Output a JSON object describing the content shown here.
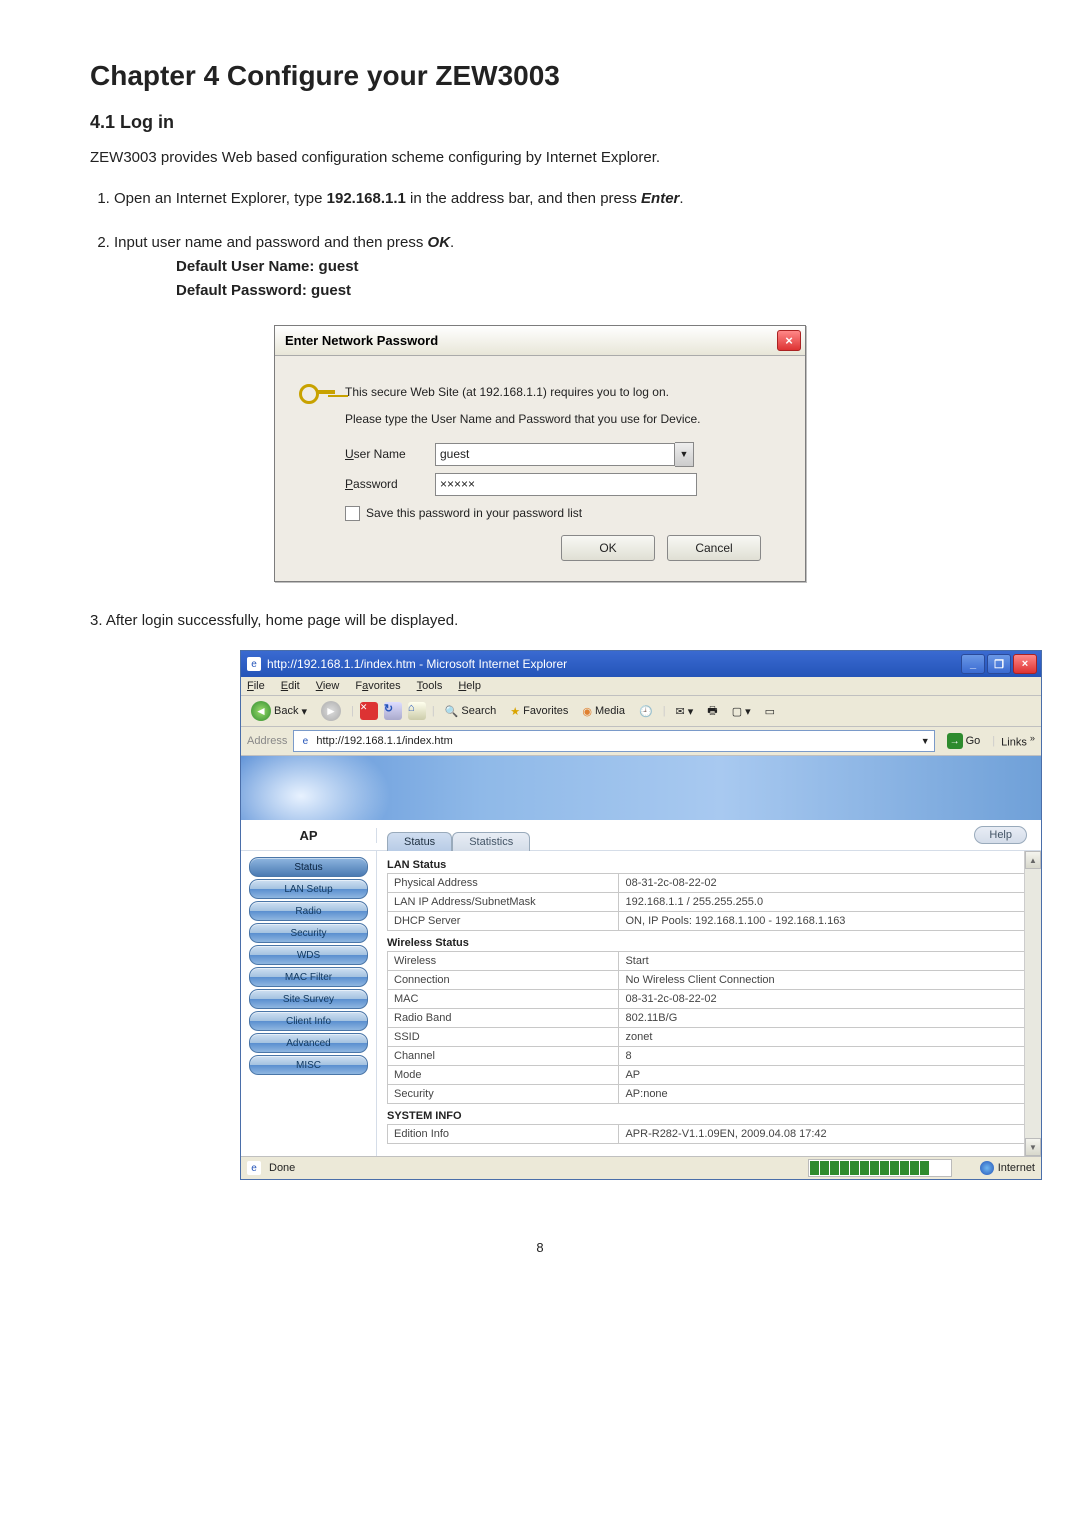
{
  "page_number": "8",
  "h1": "Chapter 4 Configure your ZEW3003",
  "h2": "4.1 Log in",
  "intro": "ZEW3003 provides Web based configuration scheme configuring by Internet Explorer.",
  "step1_a": "Open an Internet Explorer, type ",
  "step1_bold": "192.168.1.1",
  "step1_b": " in the address bar, and then press ",
  "step1_italic": "Enter",
  "step1_c": ".",
  "step2_a": "Input user name and password and then press ",
  "step2_italic": "OK",
  "step2_b": ".",
  "defaults": {
    "user_line": "Default User Name: guest",
    "pass_line": "Default Password: guest"
  },
  "step3": "3. After login successfully, home page will be displayed.",
  "dialog": {
    "title": "Enter Network Password",
    "msg1": "This secure Web Site (at 192.168.1.1) requires you to log on.",
    "msg2": "Please type the User Name and Password that you use for Device.",
    "user_label_pre": "U",
    "user_label_rest": "ser Name",
    "user_value": "guest",
    "pass_label_pre": "P",
    "pass_label_rest": "assword",
    "pass_value": "×××××",
    "save_pre": "S",
    "save_rest": "ave this password in your password list",
    "ok": "OK",
    "cancel": "Cancel"
  },
  "ie": {
    "title": "http://192.168.1.1/index.htm - Microsoft Internet Explorer",
    "menu": {
      "file_u": "F",
      "file": "ile",
      "edit_u": "E",
      "edit": "dit",
      "view_u": "V",
      "view": "iew",
      "fav": "F",
      "fav_u": "a",
      "fav2": "vorites",
      "tools_u": "T",
      "tools": "ools",
      "help_u": "H",
      "help": "elp"
    },
    "toolbar": {
      "back": "Back",
      "search": "Search",
      "favorites": "Favorites",
      "media": "Media"
    },
    "addr_label_pre": "A",
    "addr_label_u": "d",
    "addr_label_rest": "dress",
    "address": "http://192.168.1.1/index.htm",
    "go": "Go",
    "links": "Links",
    "ap": "AP",
    "subtab_status": "Status",
    "subtab_stats": "Statistics",
    "help": "Help",
    "sidebar": [
      "Status",
      "LAN Setup",
      "Radio",
      "Security",
      "WDS",
      "MAC Filter",
      "Site Survey",
      "Client Info",
      "Advanced",
      "MISC"
    ],
    "lan_h": "LAN Status",
    "lan": [
      [
        "Physical Address",
        "08-31-2c-08-22-02"
      ],
      [
        "LAN IP Address/SubnetMask",
        "192.168.1.1 / 255.255.255.0"
      ],
      [
        "DHCP Server",
        "ON, IP Pools: 192.168.1.100 - 192.168.1.163"
      ]
    ],
    "wl_h": "Wireless Status",
    "wl": [
      [
        "Wireless",
        "Start"
      ],
      [
        "Connection",
        "No Wireless Client Connection"
      ],
      [
        "MAC",
        "08-31-2c-08-22-02"
      ],
      [
        "Radio Band",
        "802.11B/G"
      ],
      [
        "SSID",
        "zonet"
      ],
      [
        "Channel",
        "8"
      ],
      [
        "Mode",
        "AP"
      ],
      [
        "Security",
        "AP:none"
      ]
    ],
    "sys_h": "SYSTEM INFO",
    "sys": [
      [
        "Edition Info",
        "APR-R282-V1.1.09EN, 2009.04.08 17:42"
      ]
    ],
    "status_done": "Done",
    "status_internet": "Internet"
  }
}
